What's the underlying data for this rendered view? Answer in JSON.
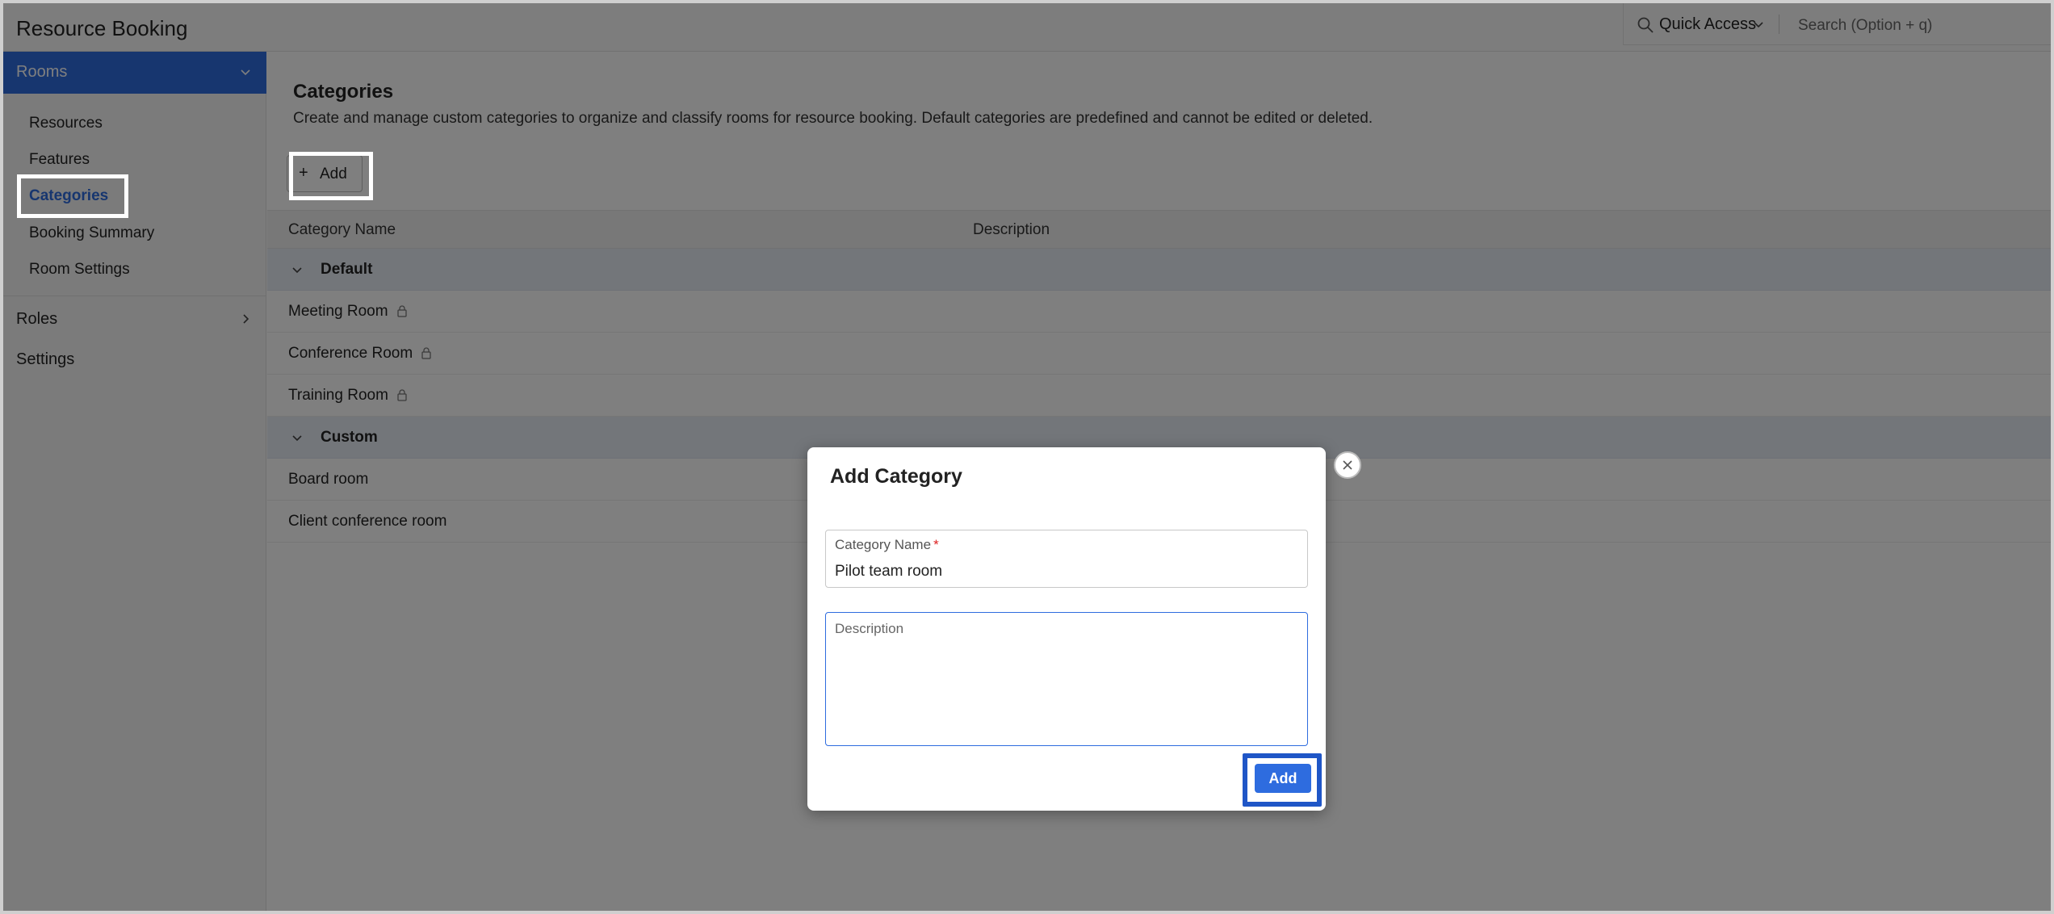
{
  "app": {
    "title": "Resource Booking"
  },
  "topbar": {
    "quick_access_label": "Quick Access",
    "search_placeholder": "Search (Option + q)"
  },
  "sidebar": {
    "section_label": "Rooms",
    "items": [
      {
        "label": "Resources"
      },
      {
        "label": "Features"
      },
      {
        "label": "Categories",
        "active": true
      },
      {
        "label": "Booking Summary"
      },
      {
        "label": "Room Settings"
      }
    ],
    "roles_label": "Roles",
    "settings_label": "Settings"
  },
  "main": {
    "title": "Categories",
    "description": "Create and manage custom categories to organize and classify rooms for resource booking. Default categories are predefined and cannot be edited or deleted.",
    "add_button_label": "Add",
    "table": {
      "columns": [
        "Category Name",
        "Description"
      ],
      "groups": [
        {
          "label": "Default",
          "rows": [
            "Meeting Room",
            "Conference Room",
            "Training Room"
          ],
          "locked": true
        },
        {
          "label": "Custom",
          "rows": [
            "Board room",
            "Client conference room"
          ],
          "locked": false
        }
      ]
    }
  },
  "modal": {
    "title": "Add Category",
    "name_label": "Category Name",
    "required_mark": "*",
    "name_value": "Pilot team room",
    "description_label": "Description",
    "submit_label": "Add"
  },
  "colors": {
    "accent": "#2e6cdf",
    "highlight": "#ffffff",
    "focus_highlight": "#1f56c7"
  }
}
